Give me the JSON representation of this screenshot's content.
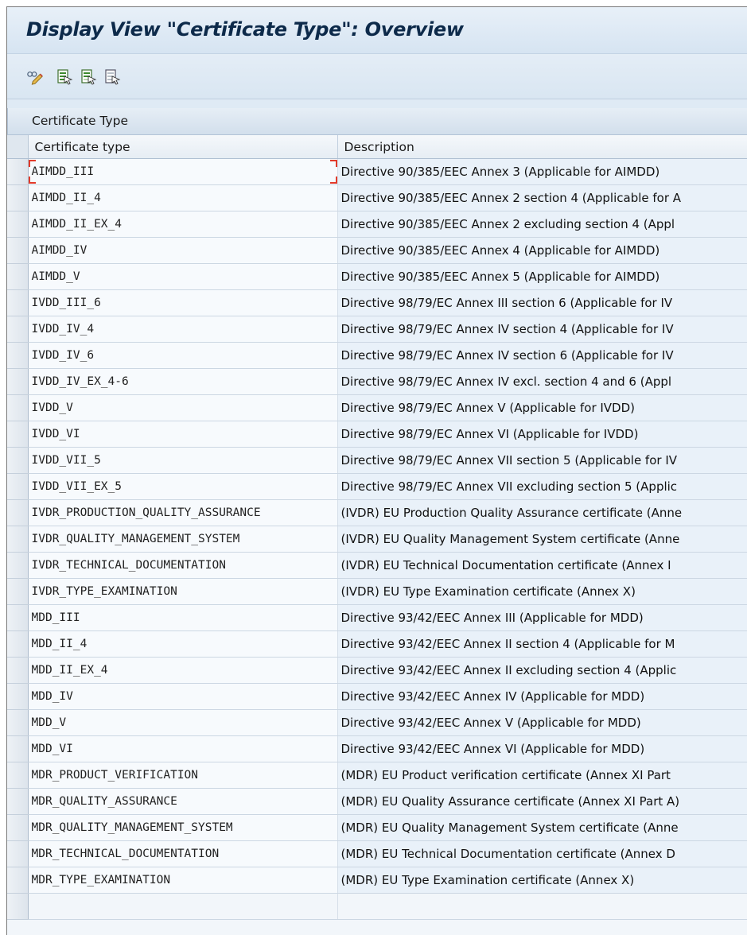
{
  "window": {
    "title": "Display View \"Certificate Type\": Overview"
  },
  "toolbar": {
    "icons": [
      "display-change-icon",
      "select-all-icon",
      "select-block-icon",
      "deselect-all-icon"
    ]
  },
  "table": {
    "panel_title": "Certificate Type",
    "columns": {
      "type": "Certificate type",
      "description": "Description"
    },
    "rows": [
      {
        "type": "AIMDD_III",
        "description": "Directive 90/385/EEC Annex 3 (Applicable for AIMDD)"
      },
      {
        "type": "AIMDD_II_4",
        "description": "Directive 90/385/EEC Annex 2 section 4 (Applicable for A"
      },
      {
        "type": "AIMDD_II_EX_4",
        "description": "Directive 90/385/EEC Annex 2 excluding section 4 (Appl"
      },
      {
        "type": "AIMDD_IV",
        "description": "Directive 90/385/EEC Annex 4 (Applicable for AIMDD)"
      },
      {
        "type": "AIMDD_V",
        "description": "Directive 90/385/EEC Annex 5 (Applicable for AIMDD)"
      },
      {
        "type": "IVDD_III_6",
        "description": "Directive 98/79/EC Annex III section 6 (Applicable for IV"
      },
      {
        "type": "IVDD_IV_4",
        "description": "Directive 98/79/EC Annex IV section 4 (Applicable for IV"
      },
      {
        "type": "IVDD_IV_6",
        "description": "Directive 98/79/EC Annex IV section 6 (Applicable for IV"
      },
      {
        "type": "IVDD_IV_EX_4-6",
        "description": "Directive 98/79/EC Annex IV excl. section 4 and 6 (Appl"
      },
      {
        "type": "IVDD_V",
        "description": "Directive 98/79/EC Annex V (Applicable for IVDD)"
      },
      {
        "type": "IVDD_VI",
        "description": "Directive 98/79/EC Annex VI (Applicable for IVDD)"
      },
      {
        "type": "IVDD_VII_5",
        "description": "Directive 98/79/EC Annex VII section 5 (Applicable for IV"
      },
      {
        "type": "IVDD_VII_EX_5",
        "description": "Directive 98/79/EC Annex VII excluding section 5 (Applic"
      },
      {
        "type": "IVDR_PRODUCTION_QUALITY_ASSURANCE",
        "description": "(IVDR) EU Production Quality Assurance certificate (Anne"
      },
      {
        "type": "IVDR_QUALITY_MANAGEMENT_SYSTEM",
        "description": "(IVDR) EU Quality Management System certificate (Anne"
      },
      {
        "type": "IVDR_TECHNICAL_DOCUMENTATION",
        "description": "(IVDR) EU Technical Documentation certificate (Annex I"
      },
      {
        "type": "IVDR_TYPE_EXAMINATION",
        "description": "(IVDR) EU Type Examination certificate (Annex X)"
      },
      {
        "type": "MDD_III",
        "description": "Directive 93/42/EEC Annex III (Applicable for MDD)"
      },
      {
        "type": "MDD_II_4",
        "description": "Directive 93/42/EEC Annex II section 4 (Applicable for M"
      },
      {
        "type": "MDD_II_EX_4",
        "description": "Directive 93/42/EEC Annex II excluding section 4 (Applic"
      },
      {
        "type": "MDD_IV",
        "description": "Directive 93/42/EEC Annex IV (Applicable for MDD)"
      },
      {
        "type": "MDD_V",
        "description": "Directive 93/42/EEC Annex V (Applicable for MDD)"
      },
      {
        "type": "MDD_VI",
        "description": "Directive 93/42/EEC Annex VI (Applicable for MDD)"
      },
      {
        "type": "MDR_PRODUCT_VERIFICATION",
        "description": "(MDR) EU Product verification certificate (Annex XI Part"
      },
      {
        "type": "MDR_QUALITY_ASSURANCE",
        "description": "(MDR) EU Quality Assurance certificate (Annex XI Part A)"
      },
      {
        "type": "MDR_QUALITY_MANAGEMENT_SYSTEM",
        "description": "(MDR) EU Quality Management System certificate (Anne"
      },
      {
        "type": "MDR_TECHNICAL_DOCUMENTATION",
        "description": "(MDR) EU Technical Documentation certificate (Annex D"
      },
      {
        "type": "MDR_TYPE_EXAMINATION",
        "description": "(MDR) EU Type Examination certificate (Annex X)"
      }
    ]
  },
  "colors": {
    "focus": "#e23a2a",
    "title_text": "#0d2a4a",
    "row_alt": "#e9f1f9"
  }
}
